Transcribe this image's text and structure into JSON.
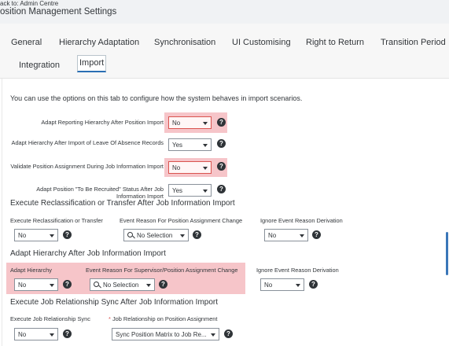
{
  "header": {
    "back_link": "ack to: Admin Centre",
    "title": "osition Management Settings"
  },
  "tabs": [
    {
      "label": "General"
    },
    {
      "label": "Hierarchy Adaptation"
    },
    {
      "label": "Synchronisation"
    },
    {
      "label": "UI Customising"
    },
    {
      "label": "Right to Return"
    },
    {
      "label": "Transition Period"
    },
    {
      "label": "Integration"
    },
    {
      "label": "Import",
      "active": true
    }
  ],
  "intro": "You can use the options on this tab to configure how the system behaves in import scenarios.",
  "form_rows": [
    {
      "label": "Adapt Reporting Hierarchy After Position Import",
      "value": "No",
      "highlighted": true
    },
    {
      "label": "Adapt Hierarchy After Import of Leave Of Absence Records",
      "value": "Yes",
      "highlighted": false
    },
    {
      "label": "Validate Position Assignment During Job Information Import",
      "value": "No",
      "highlighted": true
    },
    {
      "label": "Adapt Position \"To Be Recruited\" Status After Job Information Import",
      "value": "Yes",
      "highlighted": false
    }
  ],
  "section_reclass": {
    "title": "Execute Reclassification or Transfer After Job Information Import",
    "col1_label": "Execute Reclassification or Transfer",
    "col1_value": "No",
    "col2_label": "Event Reason For Position Assignment Change",
    "col2_value": "No Selection",
    "col3_label": "Ignore Event Reason Derivation",
    "col3_value": "No"
  },
  "section_adapt": {
    "title": "Adapt Hierarchy After Job Information Import",
    "col1_label": "Adapt Hierarchy",
    "col1_value": "No",
    "col2_label": "Event Reason For Supervisor/Position Assignment Change",
    "col2_value": "No Selection",
    "col3_label": "Ignore Event Reason Derivation",
    "col3_value": "No"
  },
  "section_sync": {
    "title": "Execute Job Relationship Sync After Job Information Import",
    "col1_label": "Execute Job Relationship Sync",
    "col1_value": "No",
    "col2_required_mark": "*",
    "col2_label": "Job Relationship on Position Assignment",
    "col2_value": "Sync Position Matrix to Job Re..."
  },
  "colors": {
    "highlight": "#f6c5c9",
    "error_border": "#d9534f",
    "active_tab_underline": "#2a6fb4",
    "scroll_indicator": "#3a76b8"
  }
}
